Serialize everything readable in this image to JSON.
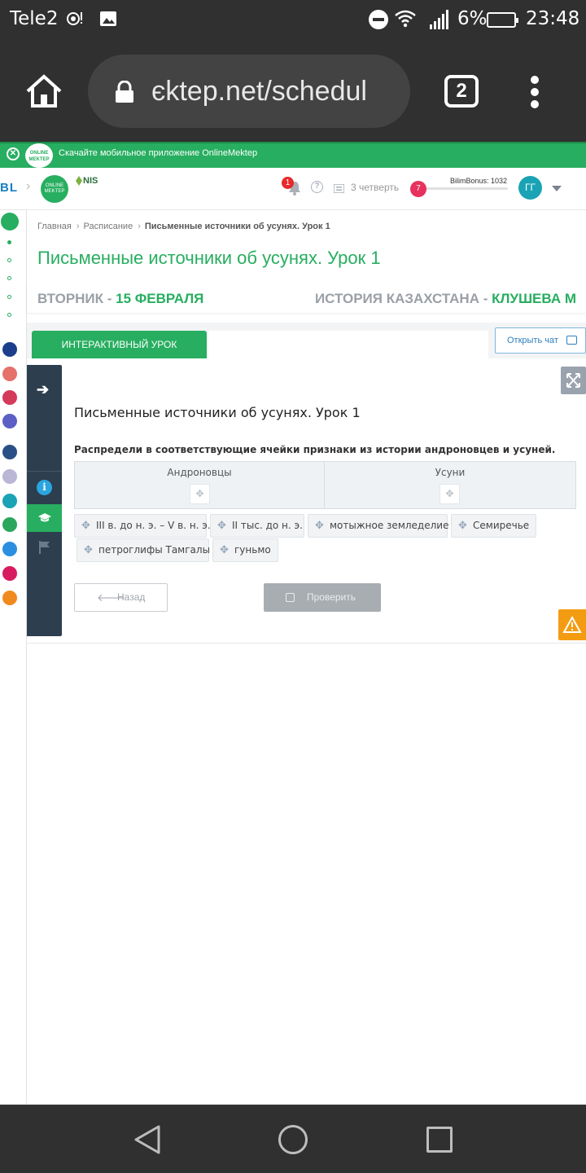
{
  "status_bar": {
    "carrier": "Tele2",
    "battery": "6%",
    "time": "23:48"
  },
  "browser": {
    "url": "єktep.net/schedul",
    "tabs_count": "2"
  },
  "banner": {
    "logo_text": "ONLINE MEKTEP",
    "text": "Скачайте мобильное приложение OnlineMektep"
  },
  "header": {
    "bl_logo": "BL",
    "om_logo": "ONLINE MEKTEP",
    "nis_logo": "NIS",
    "notifications": "1",
    "quarter": "3 четверть",
    "bonus_label": "BilimBonus: 1032",
    "bonus_progress": 0.1,
    "level": "7",
    "avatar": "ГГ"
  },
  "breadcrumb": {
    "home": "Главная",
    "schedule": "Расписание",
    "current": "Письменные источники об усунях. Урок 1"
  },
  "page": {
    "title": "Письменные источники об усунях. Урок 1",
    "day_prefix": "ВТОРНИК - ",
    "day_date": "15 ФЕВРАЛЯ",
    "subject_prefix": "ИСТОРИЯ КАЗАХСТАНА - ",
    "teacher": "КЛУШЕВА М"
  },
  "tabs": {
    "active": "ИНТЕРАКТИВНЫЙ УРОК",
    "chat_button": "Открыть чат"
  },
  "lesson": {
    "title": "Письменные источники об усунях. Урок 1",
    "instruction": "Распредели в соответствующие ячейки признаки из истории андроновцев и усуней.",
    "columns": [
      "Андроновцы",
      "Усуни"
    ],
    "chips": [
      "III в. до н. э. – V в. н. э.",
      "II тыс. до н. э.",
      "мотыжное земледелие",
      "Семиречье",
      "петроглифы Тамгалы",
      "гуньмо"
    ],
    "back_button": "Назад",
    "check_button": "Проверить"
  },
  "colors": {
    "brand_green": "#27ae60",
    "sidebar_dark": "#2d3e4f",
    "accent_blue": "#2d7fbf",
    "warning": "#f39c12"
  }
}
